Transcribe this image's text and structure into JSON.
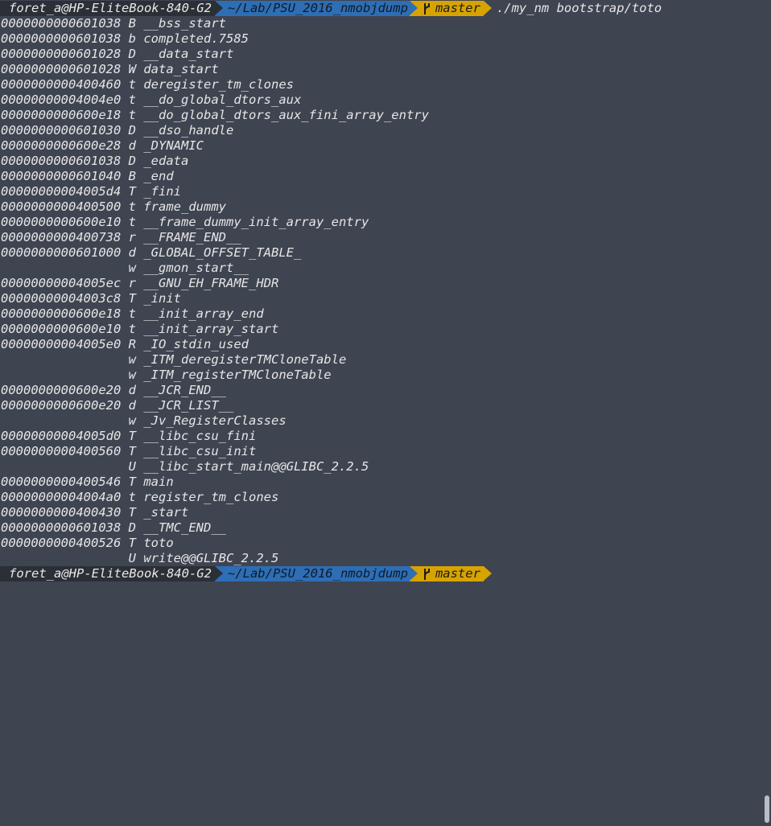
{
  "prompt": {
    "user_host": "foret_a@HP-EliteBook-840-G2",
    "path": "~/Lab/PSU_2016_nmobjdump",
    "branch": "master",
    "command": "./my_nm bootstrap/toto"
  },
  "output": [
    {
      "addr": "0000000000601038",
      "type": "B",
      "sym": "__bss_start"
    },
    {
      "addr": "0000000000601038",
      "type": "b",
      "sym": "completed.7585"
    },
    {
      "addr": "0000000000601028",
      "type": "D",
      "sym": "__data_start"
    },
    {
      "addr": "0000000000601028",
      "type": "W",
      "sym": "data_start"
    },
    {
      "addr": "0000000000400460",
      "type": "t",
      "sym": "deregister_tm_clones"
    },
    {
      "addr": "00000000004004e0",
      "type": "t",
      "sym": "__do_global_dtors_aux"
    },
    {
      "addr": "0000000000600e18",
      "type": "t",
      "sym": "__do_global_dtors_aux_fini_array_entry"
    },
    {
      "addr": "0000000000601030",
      "type": "D",
      "sym": "__dso_handle"
    },
    {
      "addr": "0000000000600e28",
      "type": "d",
      "sym": "_DYNAMIC"
    },
    {
      "addr": "0000000000601038",
      "type": "D",
      "sym": "_edata"
    },
    {
      "addr": "0000000000601040",
      "type": "B",
      "sym": "_end"
    },
    {
      "addr": "00000000004005d4",
      "type": "T",
      "sym": "_fini"
    },
    {
      "addr": "0000000000400500",
      "type": "t",
      "sym": "frame_dummy"
    },
    {
      "addr": "0000000000600e10",
      "type": "t",
      "sym": "__frame_dummy_init_array_entry"
    },
    {
      "addr": "0000000000400738",
      "type": "r",
      "sym": "__FRAME_END__"
    },
    {
      "addr": "0000000000601000",
      "type": "d",
      "sym": "_GLOBAL_OFFSET_TABLE_"
    },
    {
      "addr": "                ",
      "type": "w",
      "sym": "__gmon_start__"
    },
    {
      "addr": "00000000004005ec",
      "type": "r",
      "sym": "__GNU_EH_FRAME_HDR"
    },
    {
      "addr": "00000000004003c8",
      "type": "T",
      "sym": "_init"
    },
    {
      "addr": "0000000000600e18",
      "type": "t",
      "sym": "__init_array_end"
    },
    {
      "addr": "0000000000600e10",
      "type": "t",
      "sym": "__init_array_start"
    },
    {
      "addr": "00000000004005e0",
      "type": "R",
      "sym": "_IO_stdin_used"
    },
    {
      "addr": "                ",
      "type": "w",
      "sym": "_ITM_deregisterTMCloneTable"
    },
    {
      "addr": "                ",
      "type": "w",
      "sym": "_ITM_registerTMCloneTable"
    },
    {
      "addr": "0000000000600e20",
      "type": "d",
      "sym": "__JCR_END__"
    },
    {
      "addr": "0000000000600e20",
      "type": "d",
      "sym": "__JCR_LIST__"
    },
    {
      "addr": "                ",
      "type": "w",
      "sym": "_Jv_RegisterClasses"
    },
    {
      "addr": "00000000004005d0",
      "type": "T",
      "sym": "__libc_csu_fini"
    },
    {
      "addr": "0000000000400560",
      "type": "T",
      "sym": "__libc_csu_init"
    },
    {
      "addr": "                ",
      "type": "U",
      "sym": "__libc_start_main@@GLIBC_2.2.5"
    },
    {
      "addr": "0000000000400546",
      "type": "T",
      "sym": "main"
    },
    {
      "addr": "00000000004004a0",
      "type": "t",
      "sym": "register_tm_clones"
    },
    {
      "addr": "0000000000400430",
      "type": "T",
      "sym": "_start"
    },
    {
      "addr": "0000000000601038",
      "type": "D",
      "sym": "__TMC_END__"
    },
    {
      "addr": "0000000000400526",
      "type": "T",
      "sym": "toto"
    },
    {
      "addr": "                ",
      "type": "U",
      "sym": "write@@GLIBC_2.2.5"
    }
  ],
  "prompt2": {
    "user_host": "foret_a@HP-EliteBook-840-G2",
    "path": "~/Lab/PSU_2016_nmobjdump",
    "branch": "master"
  },
  "colors": {
    "background": "#3f4451",
    "user_segment": "#2b2f36",
    "path_segment": "#2d6eb5",
    "git_segment": "#d7a300"
  },
  "icons": {
    "branch": "git-branch-icon"
  }
}
